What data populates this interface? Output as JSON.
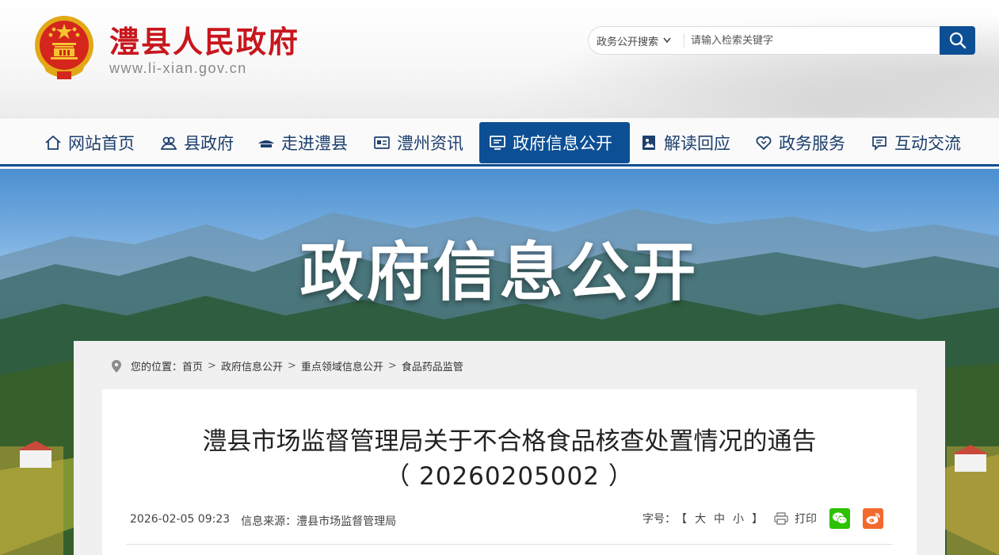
{
  "site": {
    "title": "澧县人民政府",
    "url": "www.li-xian.gov.cn"
  },
  "search": {
    "scope_label": "政务公开搜索",
    "placeholder": "请输入检索关键字"
  },
  "nav": {
    "items": [
      {
        "label": "网站首页",
        "icon": "home-icon",
        "active": false
      },
      {
        "label": "县政府",
        "icon": "people-icon",
        "active": false
      },
      {
        "label": "走进澧县",
        "icon": "landmark-icon",
        "active": false
      },
      {
        "label": "澧州资讯",
        "icon": "news-icon",
        "active": false
      },
      {
        "label": "政府信息公开",
        "icon": "monitor-icon",
        "active": true
      },
      {
        "label": "解读回应",
        "icon": "image-icon",
        "active": false
      },
      {
        "label": "政务服务",
        "icon": "heart-icon",
        "active": false
      },
      {
        "label": "互动交流",
        "icon": "chat-icon",
        "active": false
      }
    ]
  },
  "banner": {
    "title": "政府信息公开"
  },
  "breadcrumb": {
    "prefix": "您的位置：",
    "items": [
      "首页",
      "政府信息公开",
      "重点领域信息公开",
      "食品药品监管"
    ],
    "separator": ">"
  },
  "article": {
    "title_line1": "澧县市场监督管理局关于不合格食品核查处置情况的通告",
    "title_line2": "（ 20260205002 ）",
    "date": "2026-02-05 09:23",
    "source_label": "信息来源：澧县市场监督管理局",
    "font_size_label": "字号：",
    "font_size_open": "【",
    "font_size_options": [
      "大",
      "中",
      "小"
    ],
    "font_size_close": "】",
    "print_label": "打印"
  },
  "colors": {
    "brand_red": "#c8161d",
    "nav_blue": "#0d4f94",
    "wechat_green": "#2dc100",
    "weibo_orange": "#f36a30"
  }
}
